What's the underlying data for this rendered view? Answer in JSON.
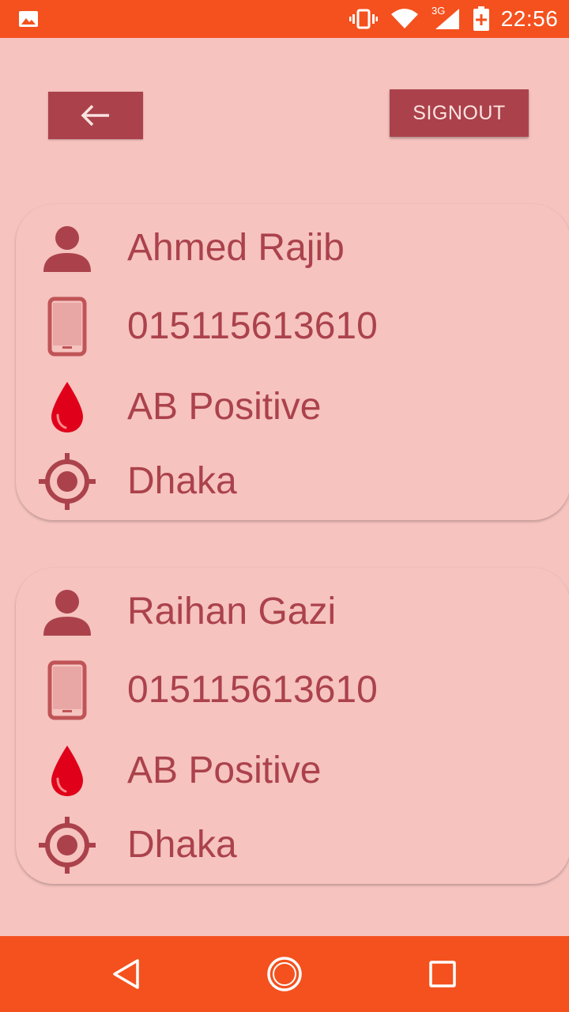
{
  "status_bar": {
    "time": "22:56",
    "network_type": "3G",
    "icons": [
      "gallery-icon",
      "vibrate-icon",
      "wifi-icon",
      "signal-icon",
      "battery-charging-icon"
    ]
  },
  "toolbar": {
    "back_icon": "arrow-left-icon",
    "signout_label": "SIGNOUT"
  },
  "colors": {
    "accent": "#ab424b",
    "background": "#f6c3bf",
    "status_bar": "#f4511e",
    "blood_drop": "#e0001a"
  },
  "donors": [
    {
      "name": "Ahmed Rajib",
      "phone": "015115613610",
      "blood_group": "AB Positive",
      "location": "Dhaka"
    },
    {
      "name": "Raihan Gazi",
      "phone": "015115613610",
      "blood_group": "AB Positive",
      "location": "Dhaka"
    }
  ],
  "nav_bar": {
    "buttons": [
      "back-triangle-icon",
      "home-circle-icon",
      "recents-square-icon"
    ]
  }
}
